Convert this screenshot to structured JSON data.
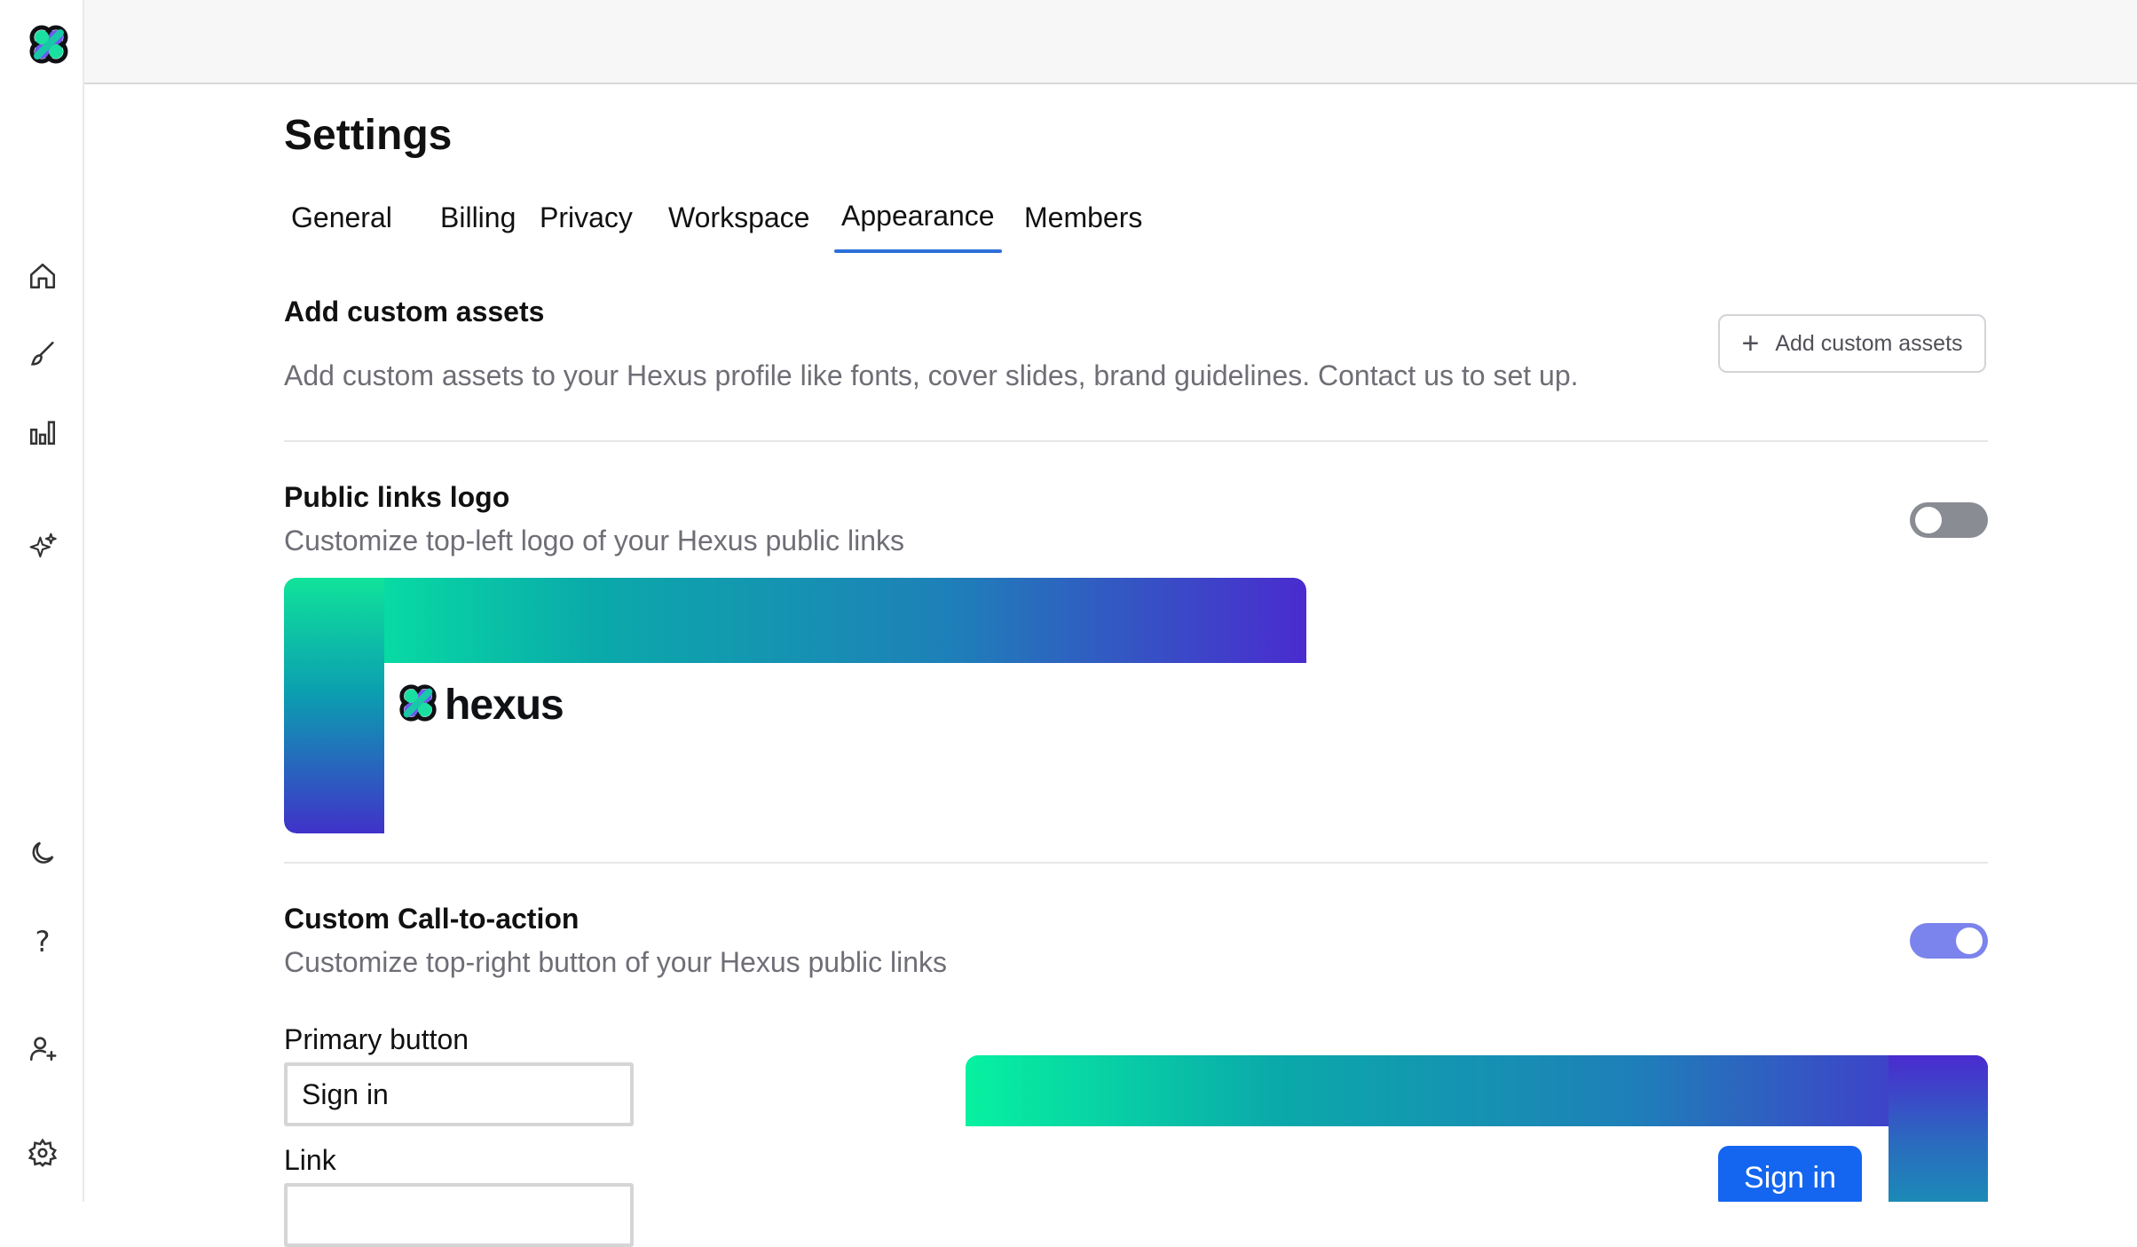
{
  "sidebar": {
    "logo": "hexus-logo-icon",
    "items": [
      {
        "icon": "home-icon"
      },
      {
        "icon": "brush-icon"
      },
      {
        "icon": "bar-chart-icon"
      },
      {
        "icon": "sparkles-icon"
      },
      {
        "icon": "moon-icon"
      },
      {
        "icon": "help-icon"
      },
      {
        "icon": "add-user-icon"
      },
      {
        "icon": "gear-icon"
      }
    ]
  },
  "page": {
    "title": "Settings",
    "tabs": [
      {
        "label": "General"
      },
      {
        "label": "Billing"
      },
      {
        "label": "Privacy"
      },
      {
        "label": "Workspace"
      },
      {
        "label": "Appearance",
        "active": true
      },
      {
        "label": "Members"
      }
    ]
  },
  "custom_assets": {
    "title": "Add custom assets",
    "description": "Add custom assets to your Hexus profile like fonts, cover slides, brand guidelines. Contact us to set up.",
    "button_label": "Add custom assets"
  },
  "public_logo": {
    "title": "Public links logo",
    "description": "Customize top-left logo of your Hexus public links",
    "enabled": false,
    "logo_text": "hexus"
  },
  "cta": {
    "title": "Custom Call-to-action",
    "description": "Customize top-right button of your Hexus public links",
    "enabled": true,
    "primary_label": "Primary button",
    "primary_value": "Sign in",
    "link_label": "Link",
    "link_value": "",
    "preview_button": "Sign in"
  },
  "colors": {
    "accent": "#2d6fd8",
    "toggle_on": "#7b83ec",
    "toggle_off": "#8a8c93",
    "cta_button": "#1466f0",
    "gradient_start": "#06f2a0",
    "gradient_end": "#4a2bcf"
  }
}
